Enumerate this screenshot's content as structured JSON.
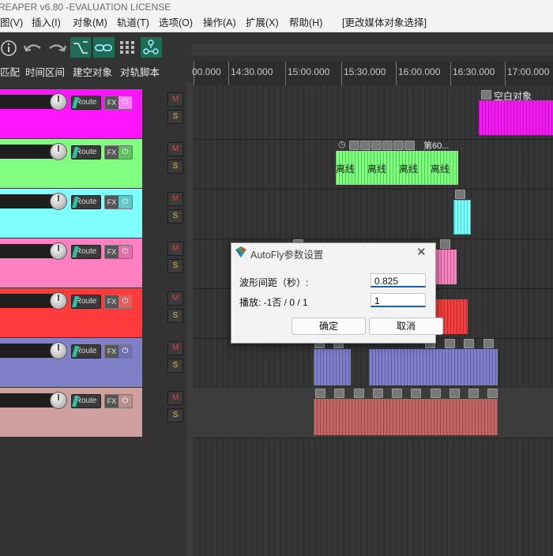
{
  "window": {
    "title": "REAPER v6.80 -EVALUATION LICENSE"
  },
  "menu": {
    "items": [
      "图(V)",
      "插入(I)",
      "对象(M)",
      "轨道(T)",
      "选项(O)",
      "操作(A)",
      "扩展(X)",
      "帮助(H)",
      "[更改媒体对象选择]"
    ]
  },
  "toolbar": {
    "icons": [
      "info-icon",
      "undo-icon",
      "redo-icon",
      "ripple-icon",
      "link-icon",
      "grid-icon",
      "share-icon"
    ],
    "labels": [
      "匹配",
      "时间区间",
      "建空对象",
      "对轨脚本"
    ]
  },
  "ruler": {
    "labels": [
      "00.000",
      "14:30.000",
      "15:00.000",
      "15:30.000",
      "16:00.000",
      "16:30.000",
      "17:00.000"
    ]
  },
  "tracks": {
    "route_label": "Route",
    "fx_label": "FX",
    "power_symbol": "⏻",
    "mute_label": "M",
    "solo_label": "S",
    "colors": [
      "#ff14ff",
      "#80ff80",
      "#80ffff",
      "#ff80c0",
      "#ff3a3a",
      "#8080c8",
      "#d0a0a0"
    ]
  },
  "items": {
    "empty_item_label": "空白对象",
    "offline_item_label": "第60...",
    "offline_text": "离线",
    "offline_segments": [
      "离线",
      "离线",
      "离线",
      "离线"
    ]
  },
  "dialog": {
    "title": "AutoFly参数设置",
    "close_symbol": "✕",
    "field1_label": "波形间距（秒）:",
    "field1_value": "0.825",
    "field2_label": "播放: -1否 / 0 / 1",
    "field2_value": "1",
    "ok_label": "确定",
    "cancel_label": "取消"
  }
}
